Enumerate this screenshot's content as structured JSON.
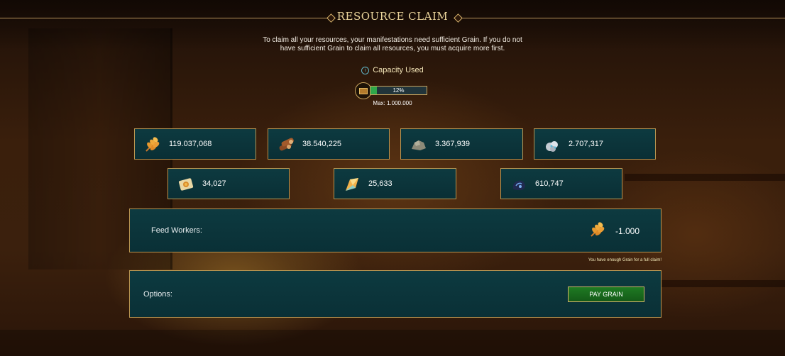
{
  "header": {
    "title": "RESOURCE CLAIM"
  },
  "description": "To claim all your resources, your manifestations need sufficient Grain. If you do not have sufficient Grain to claim all resources, you must acquire more first.",
  "capacity": {
    "label": "Capacity Used",
    "percent": 12,
    "percent_text": "12%",
    "max_text": "Max: 1.000.000"
  },
  "resources": [
    {
      "icon": "grain-icon",
      "value": "119.037,068"
    },
    {
      "icon": "wood-logs-icon",
      "value": "38.540,225"
    },
    {
      "icon": "stone-icon",
      "value": "3.367,939"
    },
    {
      "icon": "ore-icon",
      "value": "2.707,317"
    },
    {
      "icon": "scroll-icon",
      "value": "34,027"
    },
    {
      "icon": "crystal-icon",
      "value": "25,633"
    },
    {
      "icon": "dark-essence-icon",
      "value": "610,747"
    }
  ],
  "feed": {
    "label": "Feed Workers:",
    "amount": "-1.000",
    "icon": "grain-icon"
  },
  "note": "You have enough Grain for a full claim!",
  "options": {
    "label": "Options:",
    "pay_button": "PAY GRAIN"
  },
  "colors": {
    "border_gold": "#b89551",
    "panel_teal": "#0d3a40",
    "button_green": "#1f7a23",
    "title_gold": "#e9d39a"
  }
}
